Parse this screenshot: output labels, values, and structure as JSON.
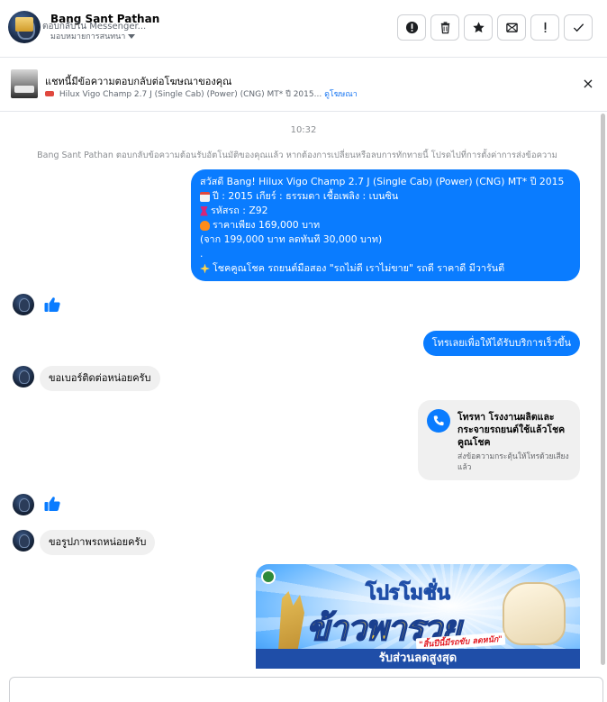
{
  "header": {
    "contact_name": "Bang Sant Pathan",
    "assign_label": "มอบหมายการสนทนา",
    "actions": [
      {
        "name": "report-icon",
        "glyph": "!"
      },
      {
        "name": "trash-icon",
        "glyph": "🗑"
      },
      {
        "name": "star-icon",
        "glyph": "★"
      },
      {
        "name": "mark-unread-icon",
        "glyph": "✉"
      },
      {
        "name": "follow-up-icon",
        "glyph": "!"
      },
      {
        "name": "check-icon",
        "glyph": "✓"
      }
    ]
  },
  "ad": {
    "title": "แชทนี้มีข้อความตอบกลับต่อโฆษณาของคุณ",
    "subtitle": "Hilux Vigo Champ 2.7 J (Single Cab) (Power) (CNG) MT* ปี 2015...",
    "link": "ดูโฆษณา"
  },
  "thread": {
    "time": "10:32",
    "system_note": "Bang Sant Pathan ตอบกลับข้อความต้อนรับอัตโนมัติของคุณแล้ว หากต้องการเปลี่ยนหรือลบการทักทายนี้ โปรดไปที่การตั้งค่าการส่งข้อความ",
    "welcome_lines": [
      "สวัสดี Bang!  Hilux Vigo Champ 2.7 J (Single Cab) (Power) (CNG) MT* ปี 2015",
      "ปี : 2015  เกียร์ : ธรรมดา  เชื้อเพลิง : เบนซิน",
      "รหัสรถ : Z92",
      "ราคาเพียง 169,000 บาท",
      "(จาก 199,000 บาท  ลดทันที 30,000 บาท)",
      ".",
      "โชคคูณโชค รถยนต์มือสอง \"รถไม่ดี เราไม่ขาย\" รถดี ราคาดี มีวารันตี"
    ],
    "call_request": "โทรเลยเพื่อให้ได้รับบริการเร็วขึ้น",
    "incoming_1": "ขอเบอร์ติดต่อหน่อยครับ",
    "call_card_title": "โทรหา โรงงานผลิตและกระจายรถยนต์ใช้แล้วโชคคูณโชค",
    "call_card_sub": "ส่งข้อความกระตุ้นให้โทรด้วยเสียงแล้ว",
    "incoming_2": "ขอรูปภาพรถหน่อยครับ",
    "promo_small": "โปรโมชั่น",
    "promo_big": "ข้าวพารวย",
    "promo_tag": "\"สิ้นปีนี้มีรถขับ ลดหนัก\"",
    "promo_bar": "รับส่วนลดสูงสุด"
  },
  "composer": {
    "placeholder": "ตอบกลับใน Messenger..."
  },
  "colors": {
    "outgoing": "#0a7cff",
    "incoming": "#f0f0f0",
    "link": "#1876f2"
  }
}
